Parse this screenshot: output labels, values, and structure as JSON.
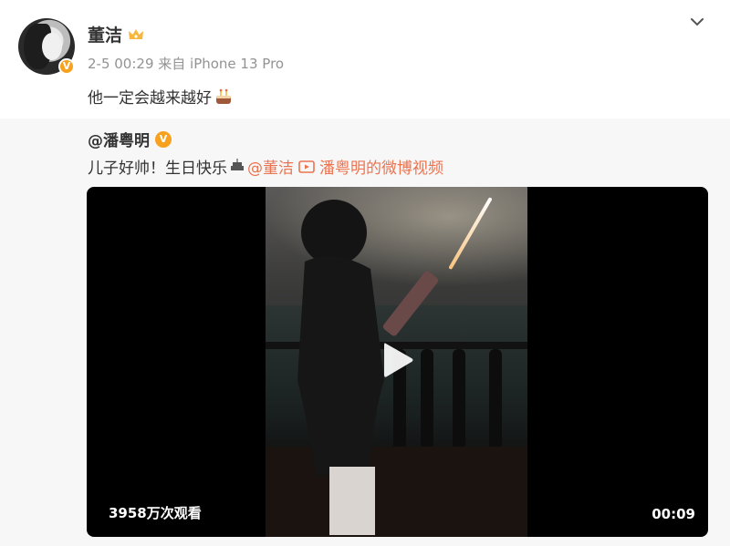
{
  "post": {
    "author": "董洁",
    "meta": "2-5 00:29  来自 iPhone 13 Pro",
    "text": "他一定会越来越好",
    "verified_label": "V"
  },
  "repost": {
    "author": "@潘粤明",
    "text_plain": "儿子好帅！生日快乐",
    "mention": "@董洁",
    "video_link": "潘粤明的微博视频",
    "verified_label": "V"
  },
  "video": {
    "views": "3958万次观看",
    "duration": "00:09"
  },
  "colors": {
    "link": "#eb7350",
    "verified": "#f7a11e",
    "repost_bg": "#f7f7f7"
  },
  "icons": [
    "crown-icon",
    "cake-icon",
    "video-link-icon",
    "play-icon",
    "close-icon",
    "verified-badge"
  ]
}
